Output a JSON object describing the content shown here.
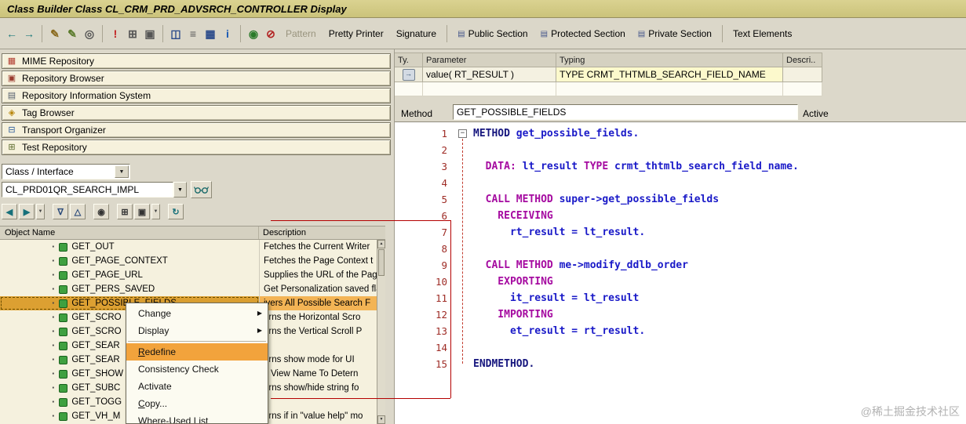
{
  "window": {
    "title": "Class Builder Class CL_CRM_PRD_ADVSRCH_CONTROLLER Display"
  },
  "colors": {
    "selection": "#DCA032",
    "selection_light": "#F3B455",
    "menu_highlight": "#F2A33C"
  },
  "toolbar": {
    "icons": [
      {
        "name": "back-icon",
        "glyph": "←",
        "color": "#1d7a7a"
      },
      {
        "name": "forward-icon",
        "glyph": "→",
        "color": "#1d7a7a"
      },
      {
        "sep": true
      },
      {
        "name": "display-change-icon",
        "glyph": "✎",
        "color": "#8a6a1e"
      },
      {
        "name": "edit-lock-icon",
        "glyph": "✎",
        "color": "#5a7a2a"
      },
      {
        "name": "refresh-object-icon",
        "glyph": "◎",
        "color": "#555555"
      },
      {
        "sep": true
      },
      {
        "name": "syntax-check-icon",
        "glyph": "!",
        "color": "#c22222"
      },
      {
        "name": "activate-icon",
        "glyph": "⊞",
        "color": "#555555"
      },
      {
        "name": "execute-icon",
        "glyph": "▣",
        "color": "#555555"
      },
      {
        "sep": true
      },
      {
        "name": "where-used-icon",
        "glyph": "◫",
        "color": "#2a4a8a"
      },
      {
        "name": "object-list-icon",
        "glyph": "≡",
        "color": "#555555"
      },
      {
        "name": "workbench-settings-icon",
        "glyph": "▦",
        "color": "#2a4a8a"
      },
      {
        "name": "information-icon",
        "glyph": "i",
        "color": "#1a5ab4"
      },
      {
        "sep": true
      },
      {
        "name": "insert-pattern-icon",
        "glyph": "◉",
        "color": "#2a7a2a"
      },
      {
        "name": "reject-icon",
        "glyph": "⊘",
        "color": "#b22222"
      }
    ],
    "text_buttons": [
      {
        "label": "Pattern",
        "disabled": true
      },
      {
        "label": "Pretty Printer"
      },
      {
        "label": "Signature"
      },
      {
        "sep": true
      },
      {
        "label": "Public Section",
        "icon": true
      },
      {
        "label": "Protected Section",
        "icon": true
      },
      {
        "label": "Private Section",
        "icon": true
      },
      {
        "sep": true
      },
      {
        "label": "Text Elements"
      }
    ]
  },
  "sidebar": {
    "repositories": [
      {
        "label": "MIME Repository",
        "icon": "mime-repository-icon",
        "glyph": "▦",
        "color": "#b03a2e"
      },
      {
        "label": "Repository Browser",
        "icon": "repository-browser-icon",
        "glyph": "▣",
        "color": "#9a3b2e"
      },
      {
        "label": "Repository Information System",
        "icon": "repository-information-icon",
        "glyph": "▤",
        "color": "#55606e"
      },
      {
        "label": "Tag Browser",
        "icon": "tag-browser-icon",
        "glyph": "◈",
        "color": "#b8860b"
      },
      {
        "label": "Transport Organizer",
        "icon": "transport-organizer-icon",
        "glyph": "⊟",
        "color": "#2a5a9a"
      },
      {
        "label": "Test Repository",
        "icon": "test-repository-icon",
        "glyph": "⊞",
        "color": "#5a6a2a"
      }
    ],
    "object_type_value": "Class / Interface",
    "object_name_value": "CL_PRD01QR_SEARCH_IMPL",
    "nav_icons": [
      {
        "name": "history-back-icon",
        "glyph": "◀",
        "color": "#17707a"
      },
      {
        "name": "history-forward-icon",
        "glyph": "▶",
        "color": "#17707a"
      },
      {
        "name": "history-list-icon",
        "glyph": "▼",
        "color": "#444444",
        "small": true
      },
      {
        "sep": true
      },
      {
        "name": "filter-icon",
        "glyph": "∇",
        "color": "#2a4a7a"
      },
      {
        "name": "sort-icon",
        "glyph": "△",
        "color": "#2a4a7a"
      },
      {
        "sep": true
      },
      {
        "name": "find-icon",
        "glyph": "◉",
        "color": "#333333"
      },
      {
        "sep": true
      },
      {
        "name": "full-view-icon",
        "glyph": "⊞",
        "color": "#333333"
      },
      {
        "name": "layout-icon",
        "glyph": "▣",
        "color": "#333333"
      },
      {
        "name": "layout-menu-icon",
        "glyph": "▼",
        "color": "#444444",
        "small": true
      },
      {
        "sep": true
      },
      {
        "name": "refresh-icon",
        "glyph": "↻",
        "color": "#17707a"
      }
    ]
  },
  "tree": {
    "columns": [
      "Object Name",
      "Description"
    ],
    "rows": [
      {
        "name": "GET_OUT",
        "desc": "Fetches the Current Writer"
      },
      {
        "name": "GET_PAGE_CONTEXT",
        "desc": "Fetches the Page Context t"
      },
      {
        "name": "GET_PAGE_URL",
        "desc": "Supplies the URL of the Pag"
      },
      {
        "name": "GET_PERS_SAVED",
        "desc": "Get Personalization saved fla"
      },
      {
        "name": "GET_POSSIBLE_FIELDS",
        "desc": "ivers All Possible Search F",
        "selected": true
      },
      {
        "name": "GET_SCRO",
        "desc": "urns the Horizontal Scro"
      },
      {
        "name": "GET_SCRO",
        "desc": "urns the Vertical Scroll P"
      },
      {
        "name": "GET_SEAR",
        "desc": ""
      },
      {
        "name": "GET_SEAR",
        "desc": "urns show mode for UI"
      },
      {
        "name": "GET_SHOW",
        "desc": "s View Name To Detern"
      },
      {
        "name": "GET_SUBC",
        "desc": "urns show/hide string fo"
      },
      {
        "name": "GET_TOGG",
        "desc": ""
      },
      {
        "name": "GET_VH_M",
        "desc": "urns if in \"value help\" mo"
      }
    ]
  },
  "context_menu": {
    "items": [
      {
        "label": "Change",
        "submenu": true
      },
      {
        "label": "Display",
        "submenu": true
      },
      {
        "sep": true
      },
      {
        "label": "Redefine",
        "highlighted": true,
        "underline": 0
      },
      {
        "label": "Consistency Check"
      },
      {
        "label": "Activate"
      },
      {
        "label": "Copy...",
        "underline": 0
      },
      {
        "label": "Where-Used List"
      }
    ]
  },
  "parameters": {
    "columns": [
      "Ty.",
      "Parameter",
      "Typing",
      "Descri.."
    ],
    "rows": [
      {
        "type_icon": "importing-parameter-icon",
        "parameter": "value( RT_RESULT )",
        "typing": "TYPE CRMT_THTMLB_SEARCH_FIELD_NAME",
        "description": ""
      }
    ]
  },
  "method_bar": {
    "label": "Method",
    "value": "GET_POSSIBLE_FIELDS",
    "status": "Active"
  },
  "editor": {
    "colors": {
      "keyword_block": "#16167E",
      "keyword": "#A50AA0",
      "identifier": "#1A1AC8",
      "line_number": "#9E2B25"
    },
    "lines": [
      {
        "n": 1,
        "segs": [
          [
            "k1",
            "METHOD"
          ],
          [
            "id",
            " get_possible_fields."
          ]
        ]
      },
      {
        "n": 2,
        "segs": []
      },
      {
        "n": 3,
        "segs": [
          [
            "k2",
            "  DATA:"
          ],
          [
            "id",
            " lt_result "
          ],
          [
            "k2",
            "TYPE"
          ],
          [
            "id",
            " crmt_thtmlb_search_field_name."
          ]
        ]
      },
      {
        "n": 4,
        "segs": []
      },
      {
        "n": 5,
        "segs": [
          [
            "k2",
            "  CALL METHOD"
          ],
          [
            "id",
            " super->get_possible_fields"
          ]
        ]
      },
      {
        "n": 6,
        "segs": [
          [
            "k2",
            "    RECEIVING"
          ]
        ]
      },
      {
        "n": 7,
        "segs": [
          [
            "id",
            "      rt_result = lt_result."
          ]
        ]
      },
      {
        "n": 8,
        "segs": []
      },
      {
        "n": 9,
        "segs": [
          [
            "k2",
            "  CALL METHOD"
          ],
          [
            "id",
            " me->modify_ddlb_order"
          ]
        ]
      },
      {
        "n": 10,
        "segs": [
          [
            "k2",
            "    EXPORTING"
          ]
        ]
      },
      {
        "n": 11,
        "segs": [
          [
            "id",
            "      it_result = lt_result"
          ]
        ]
      },
      {
        "n": 12,
        "segs": [
          [
            "k2",
            "    IMPORTING"
          ]
        ]
      },
      {
        "n": 13,
        "segs": [
          [
            "id",
            "      et_result = rt_result."
          ]
        ]
      },
      {
        "n": 14,
        "segs": []
      },
      {
        "n": 15,
        "segs": [
          [
            "k1",
            "ENDMETHOD."
          ]
        ]
      }
    ]
  },
  "watermark": "@稀土掘金技术社区"
}
